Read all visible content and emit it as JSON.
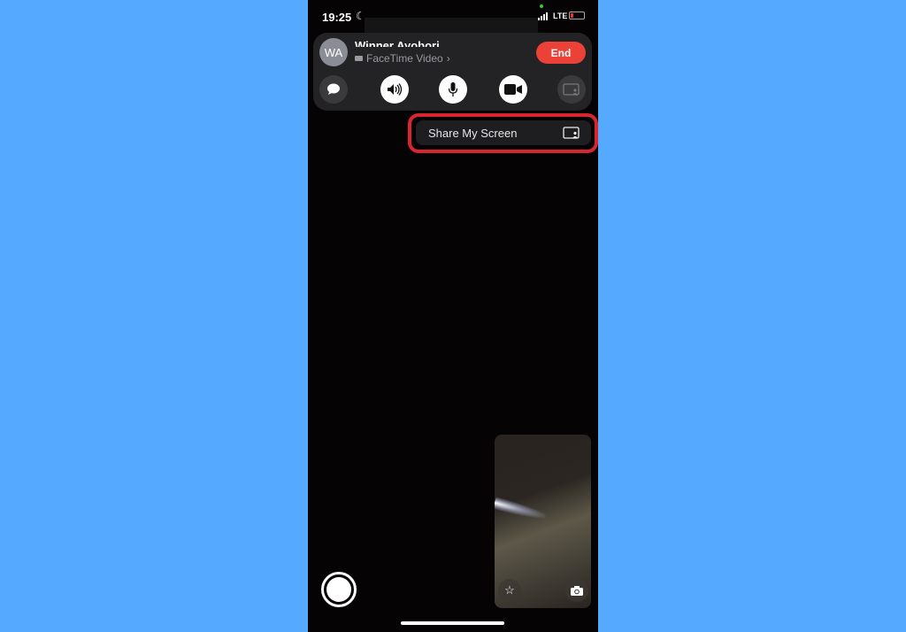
{
  "status_bar": {
    "time": "19:25",
    "network": "LTE",
    "battery_color": "#e33333"
  },
  "call": {
    "avatar_initials": "WA",
    "contact_name": "Winner Ayobori",
    "call_type": "FaceTime Video",
    "end_label": "End",
    "end_color": "#eb4137"
  },
  "controls": [
    "message-icon",
    "speaker-icon",
    "mic-icon",
    "camera-icon",
    "share-screen-icon"
  ],
  "share_menu": {
    "label": "Share My Screen",
    "highlight_color": "#d9262e"
  },
  "background_color": "#55aaff"
}
